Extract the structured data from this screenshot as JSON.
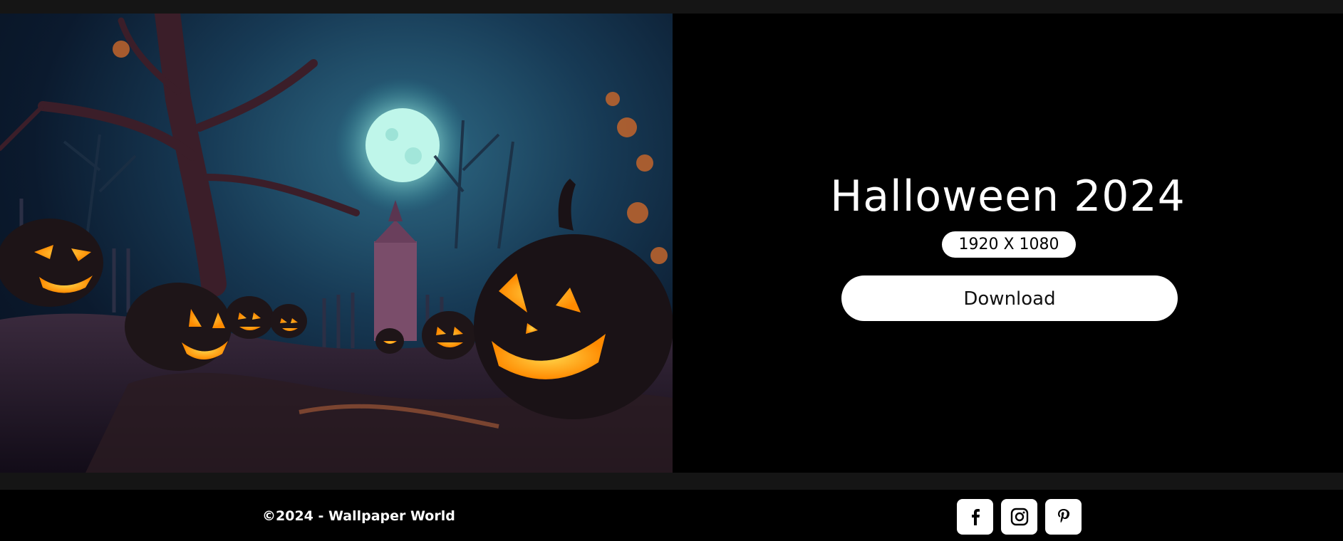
{
  "hero": {
    "title": "Halloween 2024",
    "resolution": "1920 X 1080",
    "download_label": "Download",
    "image_subject": "halloween-pumpkins-wallpaper"
  },
  "footer": {
    "copyright": "©2024 - Wallpaper World",
    "social": [
      {
        "icon": "facebook-icon"
      },
      {
        "icon": "instagram-icon"
      },
      {
        "icon": "pinterest-icon"
      }
    ]
  },
  "colors": {
    "page_background": "#151515",
    "hero_background": "#000000",
    "pill_background": "#ffffff",
    "text": "#ffffff"
  }
}
